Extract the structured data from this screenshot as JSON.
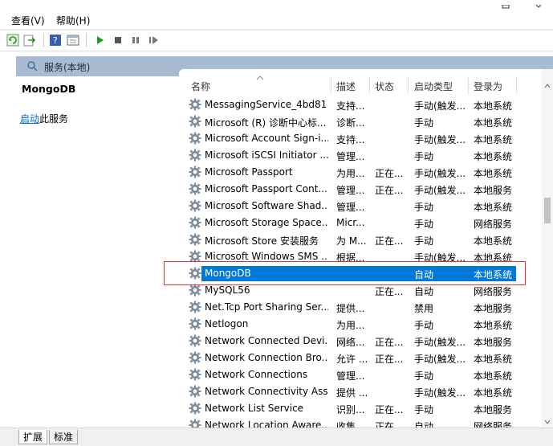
{
  "menu": {
    "view": "查看(V)",
    "help": "帮助(H)"
  },
  "toolbar": {
    "buttons": [
      "refresh-icon",
      "export-icon",
      "help-icon",
      "properties-icon",
      "start-icon",
      "stop-icon",
      "pause-icon",
      "restart-icon"
    ]
  },
  "pane_title": "服务(本地)",
  "description_pane": {
    "service_name": "MongoDB",
    "start_link": "启动",
    "start_suffix": "此服务"
  },
  "columns": {
    "name": "名称",
    "description": "描述",
    "status": "状态",
    "startup": "启动类型",
    "logon": "登录为"
  },
  "rows": [
    {
      "name": "MessagingService_4bd81",
      "desc": "支持...",
      "status": "",
      "startup": "手动(触发...",
      "logon": "本地系统"
    },
    {
      "name": "Microsoft (R) 诊断中心标...",
      "desc": "诊断...",
      "status": "",
      "startup": "手动",
      "logon": "本地系统"
    },
    {
      "name": "Microsoft Account Sign-i...",
      "desc": "支持...",
      "status": "",
      "startup": "手动(触发...",
      "logon": "本地系统"
    },
    {
      "name": "Microsoft iSCSI Initiator ...",
      "desc": "管理...",
      "status": "",
      "startup": "手动",
      "logon": "本地系统"
    },
    {
      "name": "Microsoft Passport",
      "desc": "为用...",
      "status": "正在...",
      "startup": "手动(触发...",
      "logon": "本地系统"
    },
    {
      "name": "Microsoft Passport Cont...",
      "desc": "管理...",
      "status": "正在...",
      "startup": "手动(触发...",
      "logon": "本地服务"
    },
    {
      "name": "Microsoft Software Shad...",
      "desc": "管理...",
      "status": "",
      "startup": "手动",
      "logon": "本地系统"
    },
    {
      "name": "Microsoft Storage Space...",
      "desc": "Micr...",
      "status": "",
      "startup": "手动",
      "logon": "网络服务"
    },
    {
      "name": "Microsoft Store 安装服务",
      "desc": "为 M...",
      "status": "正在...",
      "startup": "手动",
      "logon": "本地系统"
    },
    {
      "name": "Microsoft Windows SMS ...",
      "desc": "根据...",
      "status": "",
      "startup": "手动(触发...",
      "logon": "本地系统"
    },
    {
      "name": "MongoDB",
      "desc": "",
      "status": "",
      "startup": "自动",
      "logon": "本地系统"
    },
    {
      "name": "MySQL56",
      "desc": "",
      "status": "正在...",
      "startup": "自动",
      "logon": "网络服务"
    },
    {
      "name": "Net.Tcp Port Sharing Ser...",
      "desc": "提供...",
      "status": "",
      "startup": "禁用",
      "logon": "本地服务"
    },
    {
      "name": "Netlogon",
      "desc": "为用...",
      "status": "",
      "startup": "手动",
      "logon": "本地系统"
    },
    {
      "name": "Network Connected Devi...",
      "desc": "网络...",
      "status": "正在...",
      "startup": "手动(触发...",
      "logon": "本地服务"
    },
    {
      "name": "Network Connection Bro...",
      "desc": "允许 ...",
      "status": "正在...",
      "startup": "手动(触发...",
      "logon": "本地系统"
    },
    {
      "name": "Network Connections",
      "desc": "管理...",
      "status": "",
      "startup": "手动",
      "logon": "本地系统"
    },
    {
      "name": "Network Connectivity Ass...",
      "desc": "提供 ...",
      "status": "",
      "startup": "手动(触发...",
      "logon": "本地系统"
    },
    {
      "name": "Network List Service",
      "desc": "识别...",
      "status": "正在...",
      "startup": "手动",
      "logon": "本地服务"
    },
    {
      "name": "Network Location Aware...",
      "desc": "收集...",
      "status": "正在...",
      "startup": "自动",
      "logon": "网络服务"
    }
  ],
  "selected_row": 10,
  "tabs": {
    "extended": "扩展",
    "standard": "标准"
  }
}
